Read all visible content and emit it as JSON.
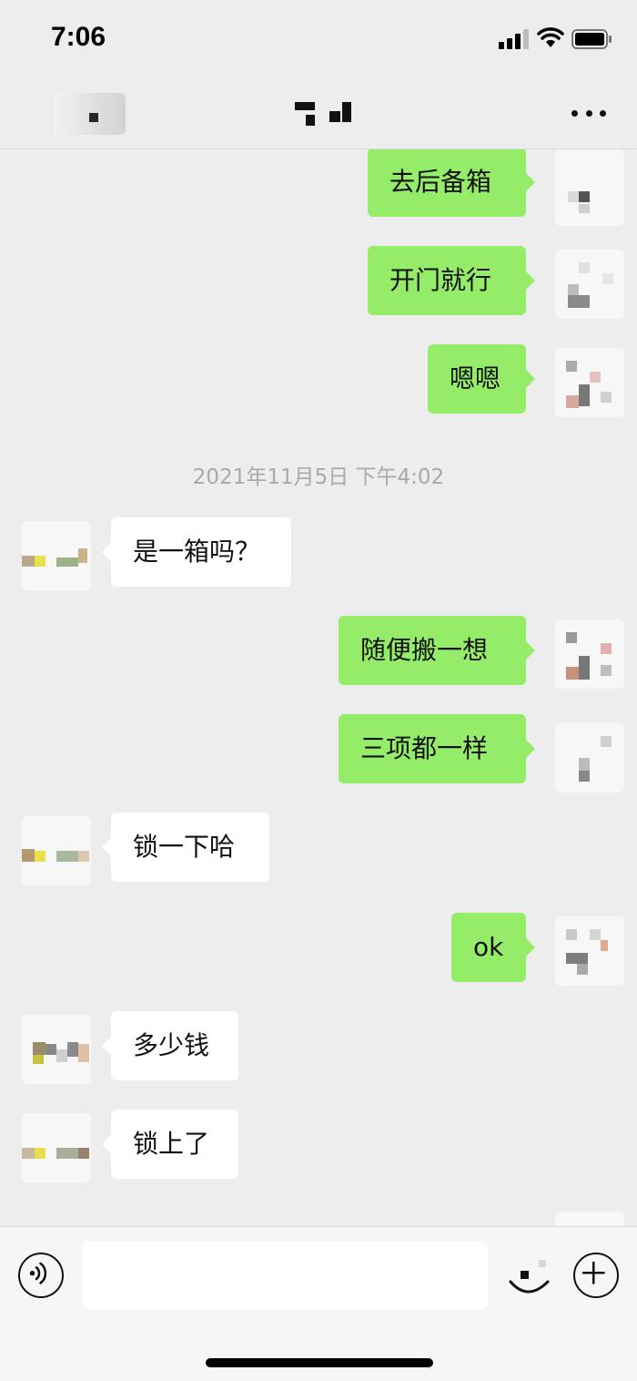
{
  "status_bar": {
    "time": "7:06",
    "icons": [
      "signal-icon",
      "wifi-icon",
      "battery-icon"
    ]
  },
  "nav": {
    "back_icon": "back-icon",
    "more_icon": "more-icon"
  },
  "colors": {
    "background": "#ededed",
    "outgoing_bubble": "#95ec69",
    "incoming_bubble": "#ffffff",
    "timestamp_text": "#a9a9a9"
  },
  "messages": [
    {
      "dir": "out",
      "text": "去后备箱"
    },
    {
      "dir": "out",
      "text": "开门就行"
    },
    {
      "dir": "out",
      "text": "嗯嗯"
    },
    {
      "dir": "time",
      "text": "2021年11月5日 下午4:02"
    },
    {
      "dir": "in",
      "text": "是一箱吗？"
    },
    {
      "dir": "out",
      "text": "随便搬一想"
    },
    {
      "dir": "out",
      "text": "三项都一样"
    },
    {
      "dir": "in",
      "text": "锁一下哈"
    },
    {
      "dir": "out",
      "text": "ok"
    },
    {
      "dir": "in",
      "text": "多少钱"
    },
    {
      "dir": "in",
      "text": "锁上了"
    },
    {
      "dir": "out",
      "text": ""
    }
  ],
  "input_bar": {
    "voice_icon": "voice-icon",
    "input_value": "",
    "emoji_icon": "emoji-icon",
    "plus_icon": "plus-icon"
  }
}
